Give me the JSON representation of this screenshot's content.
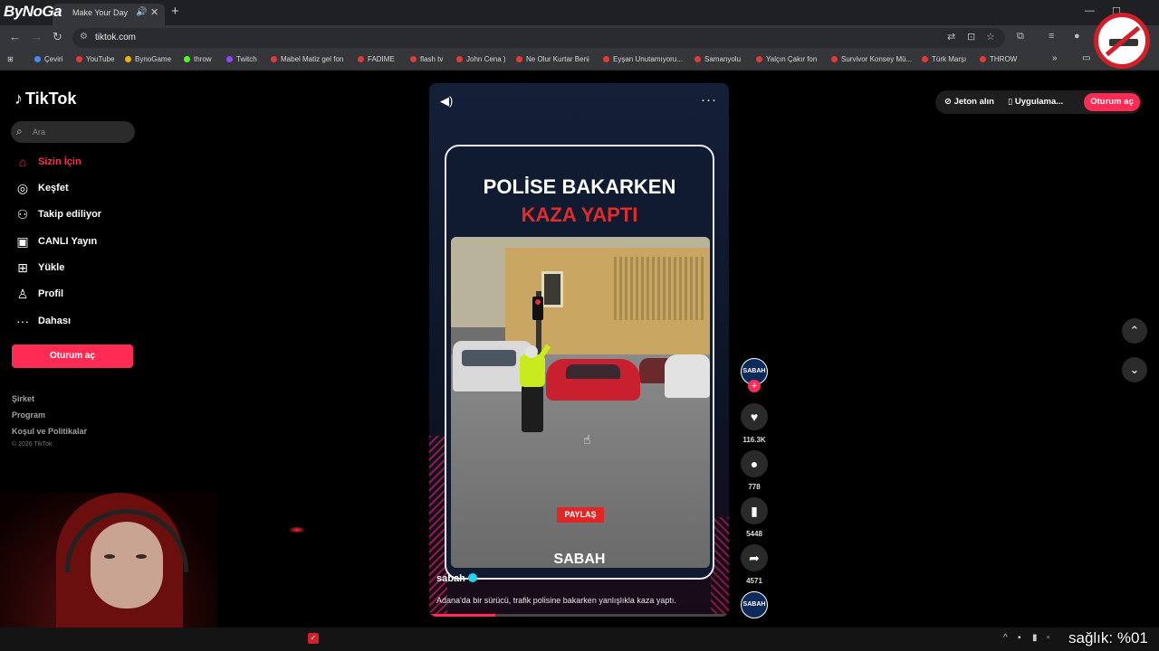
{
  "overlay_logo": "ByNoGa",
  "browser": {
    "tab_title": "Make Your Day",
    "url": "tiktok.com",
    "bookmarks": [
      {
        "label": "Çeviri"
      },
      {
        "label": "YouTube"
      },
      {
        "label": "BynoGame"
      },
      {
        "label": "throw"
      },
      {
        "label": "Twitch"
      },
      {
        "label": "Mabel Matiz gel fon"
      },
      {
        "label": "FADIME"
      },
      {
        "label": "flash tv"
      },
      {
        "label": "John Cena )"
      },
      {
        "label": "Ne Olur Kurtar Beni"
      },
      {
        "label": "Eyşan Unutamıyoru..."
      },
      {
        "label": "Samanyolu"
      },
      {
        "label": "Yalçın Çakır fon"
      },
      {
        "label": "Survivor Konsey Mü..."
      },
      {
        "label": "Türk Marşı"
      },
      {
        "label": "THROW"
      }
    ]
  },
  "tiktok": {
    "logo": "TikTok",
    "search_placeholder": "Ara",
    "nav": [
      {
        "label": "Sizin İçin",
        "icon": "home-icon"
      },
      {
        "label": "Keşfet",
        "icon": "compass-icon"
      },
      {
        "label": "Takip ediliyor",
        "icon": "following-icon"
      },
      {
        "label": "CANLI Yayın",
        "icon": "live-icon"
      },
      {
        "label": "Yükle",
        "icon": "upload-icon"
      },
      {
        "label": "Profil",
        "icon": "profile-icon"
      },
      {
        "label": "Dahası",
        "icon": "more-icon"
      }
    ],
    "login_button": "Oturum aç",
    "footer": {
      "links": [
        "Şirket",
        "Program",
        "Koşul ve Politikalar"
      ],
      "copyright": "© 2026 TikTok"
    },
    "top_right": {
      "coins": "Jeton alın",
      "app": "Uygulama...",
      "login": "Oturum aç"
    },
    "video": {
      "headline_line1": "POLİSE BAKARKEN",
      "headline_line2": "KAZA YAPTI",
      "share_tag": "PAYLAŞ",
      "card_logo": "SABAH",
      "author": "sabah",
      "caption": "Adana'da bir sürücü, trafik polisine bakarken yanlışlıkla kaza yaptı.",
      "progress": 0.22
    },
    "actions": {
      "avatar_label": "SABAH",
      "likes": "116.3K",
      "comments": "778",
      "saves": "5448",
      "shares": "4571",
      "music_label": "SABAH"
    }
  },
  "overlay_health": "sağlık: %01"
}
